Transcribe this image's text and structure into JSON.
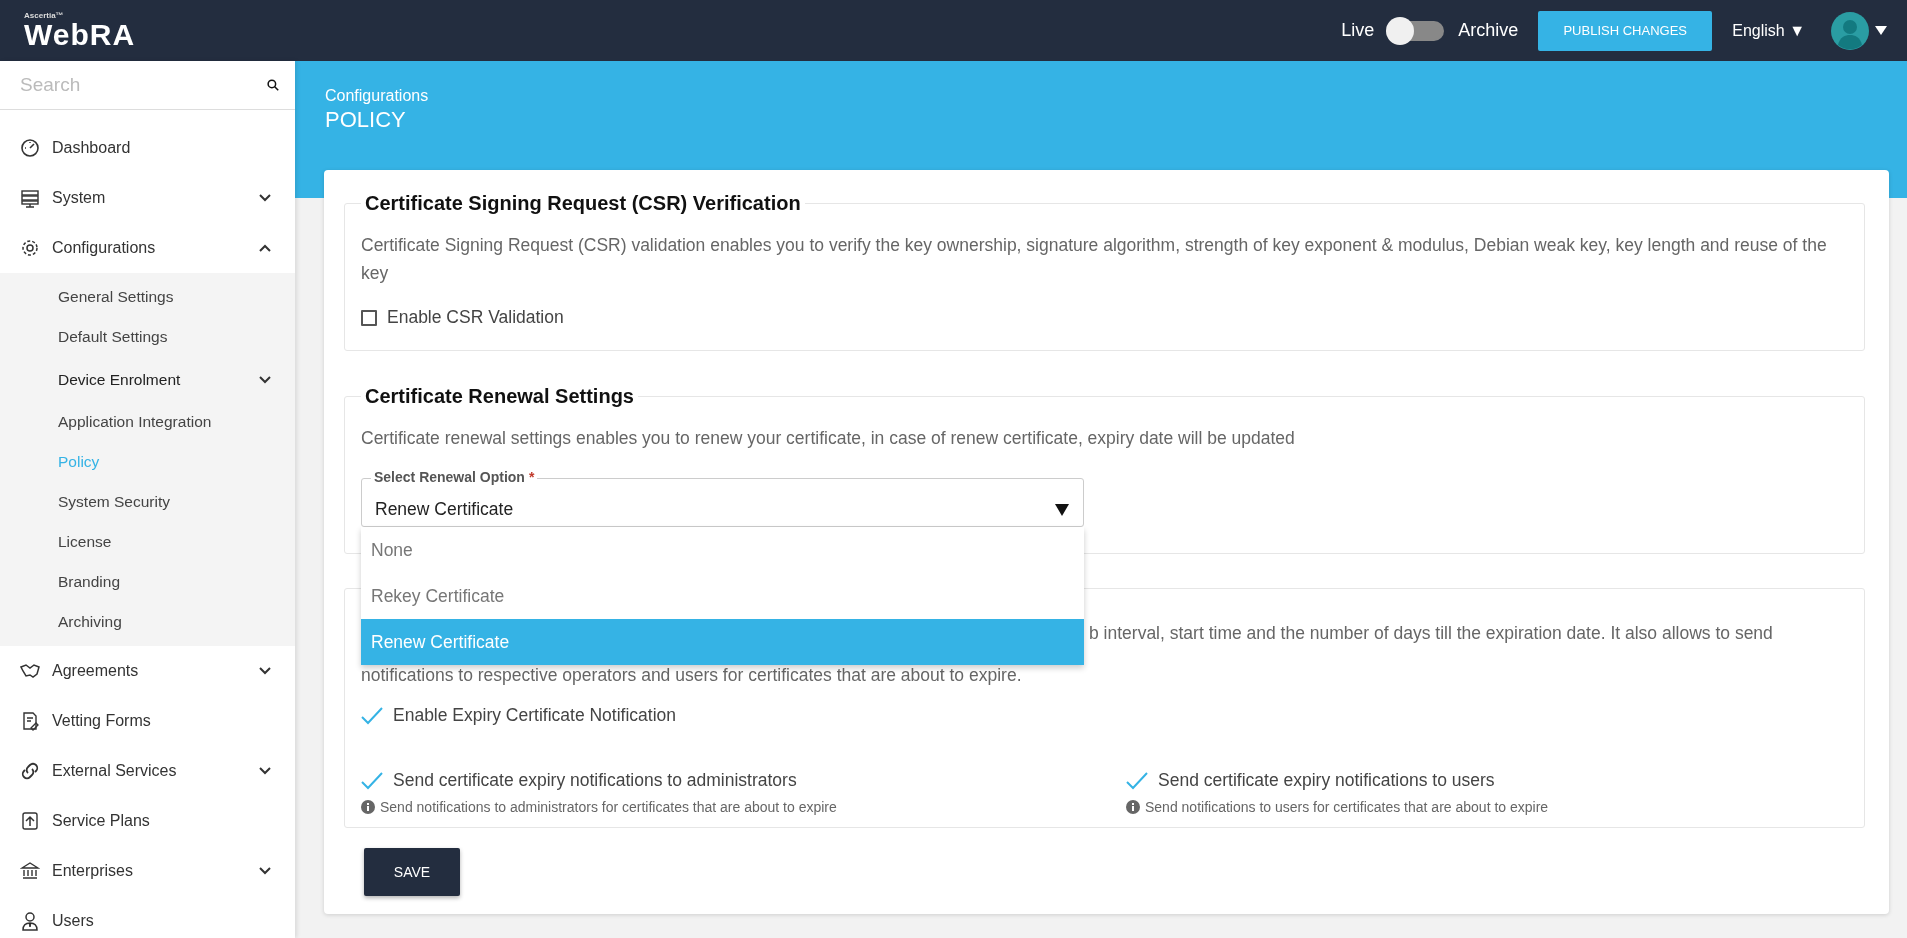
{
  "topbar": {
    "brand_mark": "Ascertia™",
    "brand": "WebRA",
    "toggle": {
      "left_label": "Live",
      "right_label": "Archive",
      "on": false
    },
    "publish_button": "PUBLISH CHANGES",
    "language": "English ▼"
  },
  "sidebar": {
    "search": {
      "placeholder": "Search"
    },
    "items": [
      {
        "label": "Dashboard",
        "kind": "link"
      },
      {
        "label": "System",
        "kind": "group",
        "expanded": false
      },
      {
        "label": "Configurations",
        "kind": "group",
        "expanded": true,
        "children": [
          {
            "label": "General Settings",
            "kind": "link",
            "selected": false
          },
          {
            "label": "Default Settings",
            "kind": "link",
            "selected": false
          },
          {
            "label": "Device Enrolment",
            "kind": "group",
            "expanded": false,
            "selected": false
          },
          {
            "label": "Application Integration",
            "kind": "link",
            "selected": false
          },
          {
            "label": "Policy",
            "kind": "link",
            "selected": true
          },
          {
            "label": "System Security",
            "kind": "link",
            "selected": false
          },
          {
            "label": "License",
            "kind": "link",
            "selected": false
          },
          {
            "label": "Branding",
            "kind": "link",
            "selected": false
          },
          {
            "label": "Archiving",
            "kind": "link",
            "selected": false
          }
        ]
      },
      {
        "label": "Agreements",
        "kind": "group",
        "expanded": false
      },
      {
        "label": "Vetting Forms",
        "kind": "link"
      },
      {
        "label": "External Services",
        "kind": "group",
        "expanded": false
      },
      {
        "label": "Service Plans",
        "kind": "link"
      },
      {
        "label": "Enterprises",
        "kind": "group",
        "expanded": false
      },
      {
        "label": "Users",
        "kind": "link"
      }
    ]
  },
  "header": {
    "breadcrumb": "Configurations",
    "title": "POLICY"
  },
  "csr": {
    "title": "Certificate Signing Request (CSR) Verification",
    "description": "Certificate Signing Request (CSR) validation enables you to verify the key ownership, signature algorithm, strength of key exponent & modulus, Debian weak key, key length and reuse of the key",
    "checkbox": {
      "label": "Enable CSR Validation",
      "checked": false
    }
  },
  "renewal": {
    "title": "Certificate Renewal Settings",
    "description": "Certificate renewal settings enables you to renew your certificate, in case of renew certificate, expiry date will be updated",
    "select": {
      "label": "Select Renewal Option",
      "required_mark": "*",
      "value": "Renew Certificate",
      "open": true,
      "options": [
        {
          "label": "None",
          "selected": false
        },
        {
          "label": "Rekey Certificate",
          "selected": false
        },
        {
          "label": "Renew Certificate",
          "selected": true
        }
      ]
    }
  },
  "expiry": {
    "description_lines": [
      "b interval, start time and the number of days till the expiration date. It also allows to send",
      "notifications to respective operators and users for certificates that are about to expire."
    ],
    "main_checkbox": {
      "label": "Enable Expiry Certificate Notification",
      "checked": true
    },
    "checkboxes": [
      {
        "label": "Send certificate expiry notifications to administrators",
        "checked": true,
        "hint": "Send notifications to administrators for certificates that are about to expire"
      },
      {
        "label": "Send certificate expiry notifications to users",
        "checked": true,
        "hint": "Send notifications to users for certificates that are about to expire"
      }
    ]
  },
  "save_button": "SAVE"
}
